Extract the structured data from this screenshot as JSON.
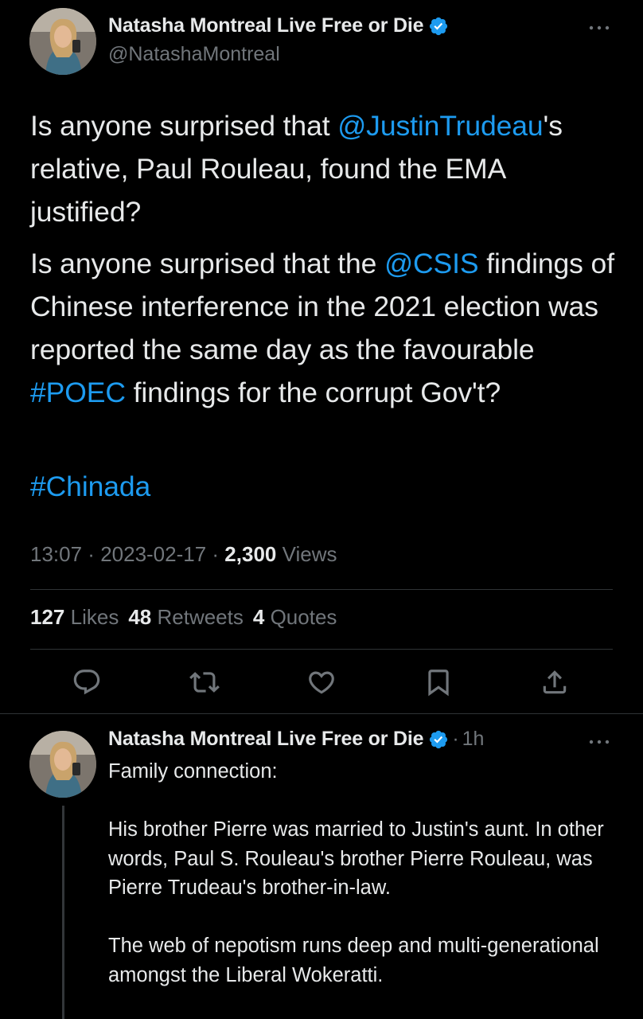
{
  "main_tweet": {
    "author": {
      "display_name": "Natasha Montreal Live Free or Die",
      "handle": "@NatashaMontreal",
      "verified_icon": "verified-badge-icon"
    },
    "text": {
      "p1": {
        "before": "Is anyone surprised that ",
        "mention": "@JustinTrudeau",
        "after": "'s relative, Paul Rouleau, found the EMA justified?"
      },
      "p2": {
        "before": "Is anyone surprised that the ",
        "mention": "@CSIS",
        "middle": " findings of Chinese interference in the 2021 election was reported the same day as the favourable ",
        "hashtag": "#POEC",
        "after": " findings for the corrupt Gov't?"
      },
      "p3": {
        "hashtag": "#Chinada"
      }
    },
    "meta": {
      "time": "13:07",
      "separator": " · ",
      "date": "2023-02-17",
      "views_count": "2,300",
      "views_label": "Views"
    },
    "stats": {
      "likes_count": "127",
      "likes_label": "Likes",
      "retweets_count": "48",
      "retweets_label": "Retweets",
      "quotes_count": "4",
      "quotes_label": "Quotes"
    },
    "actions": [
      "reply-icon",
      "retweet-icon",
      "like-icon",
      "bookmark-icon",
      "share-icon"
    ]
  },
  "reply": {
    "author": {
      "display_name": "Natasha Montreal Live Free or Die",
      "verified_icon": "verified-badge-icon"
    },
    "time_separator": "·",
    "time": "1h",
    "text": {
      "p1": "Family connection:",
      "p2": "His brother Pierre was married to Justin's aunt. In other words, Paul S. Rouleau's brother Pierre Rouleau, was Pierre Trudeau's brother-in-law.",
      "p3": "The web of nepotism runs deep and multi-generational amongst the Liberal Wokeratti."
    }
  },
  "colors": {
    "background": "#000000",
    "text_primary": "#e7e9ea",
    "text_secondary": "#71767b",
    "link": "#1d9bf0",
    "divider": "#2f3336"
  }
}
